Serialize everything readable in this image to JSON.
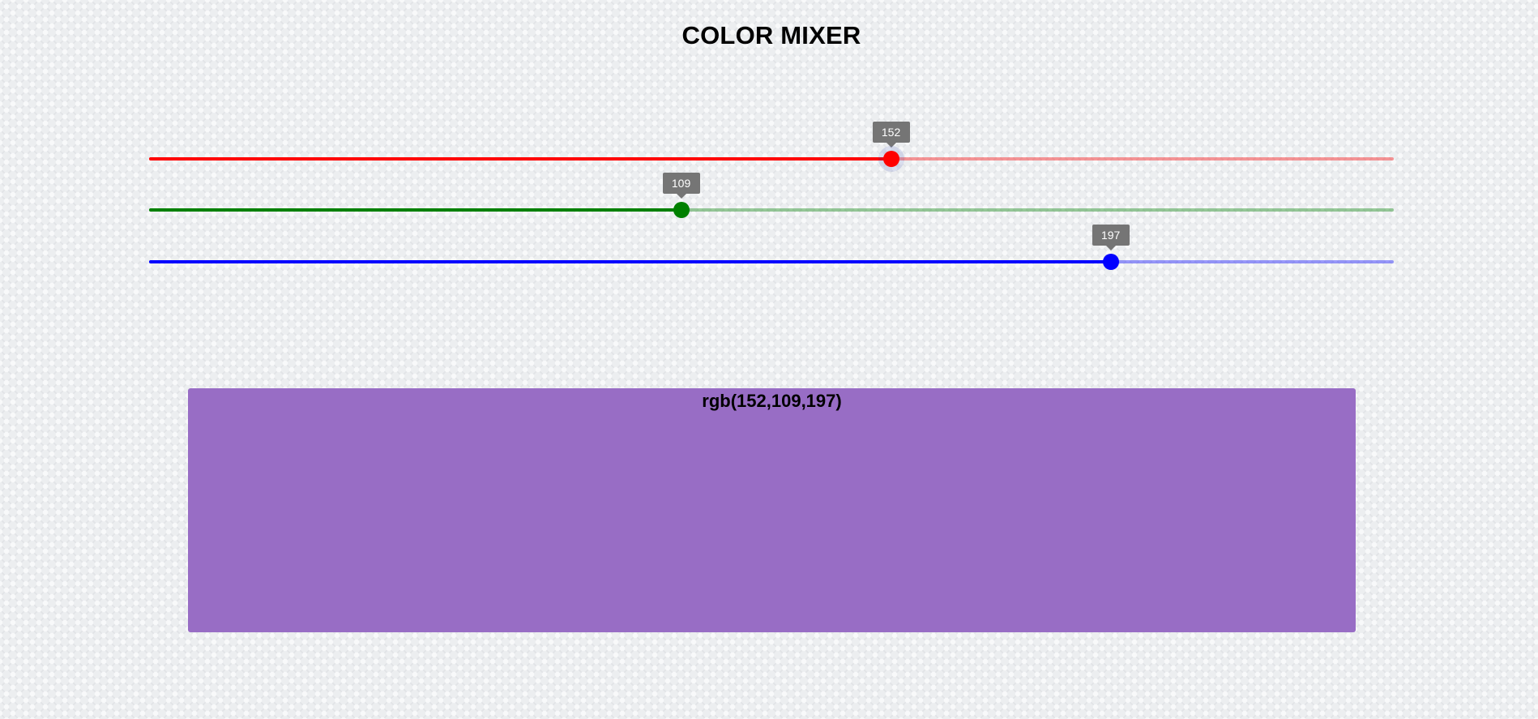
{
  "app": {
    "title": "COLOR MIXER"
  },
  "sliders": [
    {
      "channel": "red",
      "value": 152,
      "label": "152",
      "min": 0,
      "max": 255,
      "color": "#ff0000",
      "active": true
    },
    {
      "channel": "green",
      "value": 109,
      "label": "109",
      "min": 0,
      "max": 255,
      "color": "#008000",
      "active": false
    },
    {
      "channel": "blue",
      "value": 197,
      "label": "197",
      "min": 0,
      "max": 255,
      "color": "#0000ff",
      "active": false
    }
  ],
  "preview": {
    "text": "rgb(152,109,197)",
    "color": "#986dc5"
  }
}
